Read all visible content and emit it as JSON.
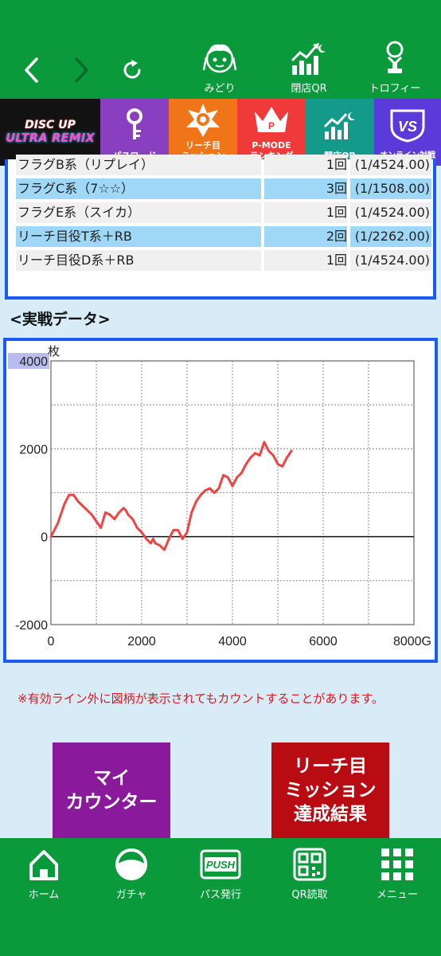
{
  "header": {
    "back_icon": "chevron-left-icon",
    "forward_icon": "chevron-right-icon",
    "reload_icon": "reload-icon",
    "items": [
      {
        "label": "みどり",
        "icon": "character-avatar-icon"
      },
      {
        "label": "閉店QR",
        "icon": "growth-chart-icon"
      },
      {
        "label": "トロフィー",
        "icon": "trophy-icon"
      }
    ]
  },
  "menu_strip": {
    "logo_line1": "DISC UP",
    "logo_line2": "ULTRA REMIX",
    "tiles": [
      {
        "label": "パスワード",
        "icon": "key-icon",
        "color": "#8a3fc0"
      },
      {
        "label": "リーチ目\nミッション",
        "icon": "star-badge-icon",
        "color": "#f07418"
      },
      {
        "label": "P-MODE\nランキング",
        "icon": "crown-icon",
        "color": "#f03a3a"
      },
      {
        "label": "閉店QR",
        "icon": "growth-chart-icon",
        "color": "#149a8a"
      },
      {
        "label": "オンライン対戦",
        "icon": "vs-badge-icon",
        "color": "#5a3ad8"
      }
    ]
  },
  "flag_table": {
    "rows": [
      {
        "name": "フラグB系（リプレイ）",
        "count": "1回",
        "prob": "(1/4524.00)",
        "style": "norm"
      },
      {
        "name": "フラグC系（7☆☆）",
        "count": "3回",
        "prob": "(1/1508.00)",
        "style": "hl"
      },
      {
        "name": "フラグE系（スイカ）",
        "count": "1回",
        "prob": "(1/4524.00)",
        "style": "norm"
      },
      {
        "name": "リーチ目役T系＋RB",
        "count": "2回",
        "prob": "(1/2262.00)",
        "style": "hl"
      },
      {
        "name": "リーチ目役D系＋RB",
        "count": "1回",
        "prob": "(1/4524.00)",
        "style": "norm"
      }
    ]
  },
  "section_title": "<実戦データ>",
  "chart_data": {
    "type": "line",
    "ylabel": "枚",
    "xlabel": "",
    "x_unit_suffix": "G",
    "xlim": [
      0,
      8000
    ],
    "ylim": [
      -2000,
      4000
    ],
    "x_ticks": [
      "0",
      "2000",
      "4000",
      "6000",
      "8000G"
    ],
    "y_ticks": [
      "4000",
      "2000",
      "0",
      "-2000"
    ],
    "grid": true,
    "line_color": "#ee4444",
    "series": [
      {
        "x": [
          0,
          150,
          300,
          400,
          500,
          600,
          700,
          800,
          900,
          1000,
          1100,
          1200,
          1300,
          1400,
          1500,
          1600,
          1650,
          1700,
          1800,
          1900,
          2000,
          2100,
          2200,
          2250,
          2300,
          2400,
          2500,
          2600,
          2700,
          2800,
          2900,
          3000,
          3100,
          3200,
          3300,
          3400,
          3500,
          3600,
          3700,
          3800,
          3900,
          4000,
          4100,
          4200,
          4300,
          4400,
          4500,
          4600,
          4700,
          4800,
          4900,
          5000,
          5100,
          5200,
          5300
        ],
        "y": [
          0,
          300,
          750,
          950,
          950,
          800,
          700,
          600,
          500,
          350,
          200,
          550,
          500,
          400,
          550,
          650,
          600,
          500,
          400,
          200,
          100,
          -50,
          -150,
          -50,
          -150,
          -200,
          -300,
          -50,
          150,
          150,
          -50,
          100,
          550,
          800,
          950,
          1050,
          1100,
          1000,
          1100,
          1400,
          1350,
          1150,
          1350,
          1450,
          1650,
          1800,
          1900,
          1850,
          2150,
          1950,
          1850,
          1650,
          1600,
          1800,
          1950
        ]
      }
    ]
  },
  "note": "※有効ライン外に図柄が表示されてもカウントすることがあります。",
  "buttons": {
    "my_counter": "マイ\nカウンター",
    "mission_result": "リーチ目\nミッション\n達成結果"
  },
  "bottom_nav": [
    {
      "label": "ホーム",
      "icon": "home-icon"
    },
    {
      "label": "ガチャ",
      "icon": "gacha-capsule-icon"
    },
    {
      "label": "パス発行",
      "icon": "push-pass-icon"
    },
    {
      "label": "QR読取",
      "icon": "qr-code-icon"
    },
    {
      "label": "メニュー",
      "icon": "grid-menu-icon"
    }
  ]
}
